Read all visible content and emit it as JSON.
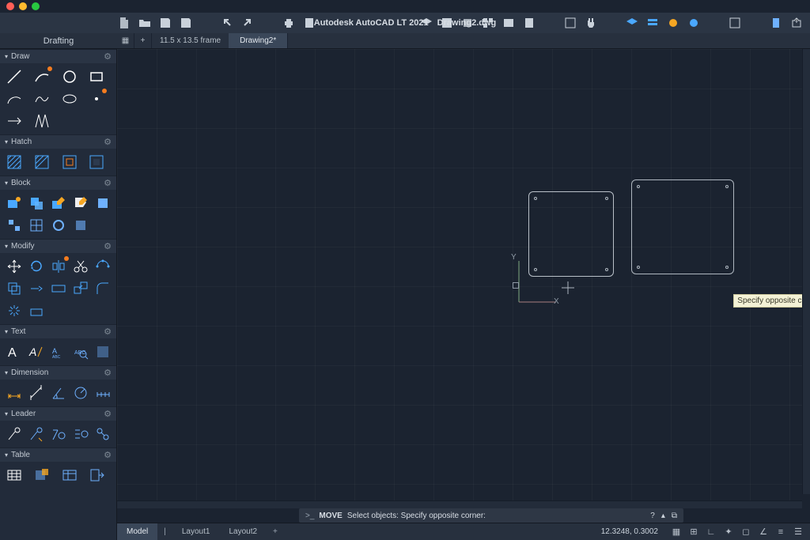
{
  "app": {
    "title": "Autodesk AutoCAD LT 2021",
    "doc": "Drawing2.dwg"
  },
  "viewport": {
    "frame_label": "11.5 x 13.5 frame",
    "tab_name": "Drawing2*"
  },
  "sidebar": {
    "title": "Drafting",
    "sections": {
      "draw": "Draw",
      "hatch": "Hatch",
      "block": "Block",
      "modify": "Modify",
      "text": "Text",
      "dimension": "Dimension",
      "leader": "Leader",
      "table": "Table"
    }
  },
  "ucs": {
    "x": "X",
    "y": "Y"
  },
  "tooltip": "Specify opposite co",
  "command": {
    "prefix": ">_",
    "name": "MOVE",
    "prompt": "Select objects: Specify opposite corner:"
  },
  "bottom": {
    "tabs": {
      "model": "Model",
      "layout1": "Layout1",
      "layout2": "Layout2"
    },
    "coords": "12.3248, 0.3002"
  }
}
